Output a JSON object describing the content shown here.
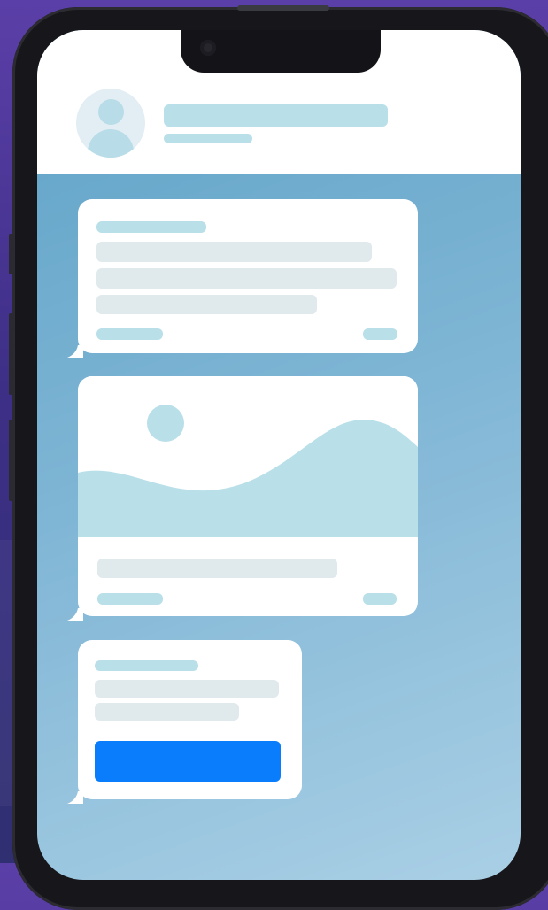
{
  "app": {
    "description_icons": [
      "contact-avatar-icon",
      "image-placeholder-icon"
    ],
    "colors": {
      "background_top": "#5b3fa8",
      "background_bottom": "#2f2f72",
      "phone_frame": "#17171b",
      "chat_background": "#7db4d4",
      "placeholder_blue": "#b9dfe9",
      "placeholder_gray": "#e0e9ec",
      "bubble": "#ffffff",
      "button": "#0a7dfd"
    }
  },
  "header": {
    "contact_name": "",
    "contact_status": ""
  },
  "messages": [
    {
      "type": "text",
      "sender_label": "",
      "text_lines": [
        "",
        "",
        ""
      ],
      "meta_left": "",
      "meta_right": ""
    },
    {
      "type": "image",
      "caption": "",
      "meta_left": "",
      "meta_right": ""
    },
    {
      "type": "action",
      "title": "",
      "text_lines": [
        "",
        ""
      ],
      "button_label": ""
    }
  ]
}
